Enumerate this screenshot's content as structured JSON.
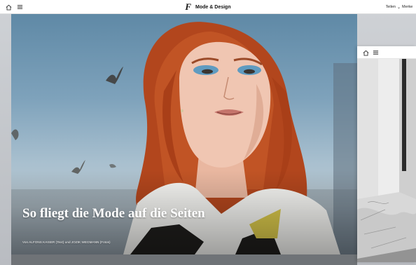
{
  "topbar": {
    "home_icon": "home-icon",
    "menu_icon": "menu-icon",
    "logo": "F",
    "title": "Mode & Design",
    "share_label": "Teilen",
    "more_label": "Merke"
  },
  "hero": {
    "headline": "So fliegt die Mode auf die Seiten",
    "byline": "Von ALFONS KAISER (Text) und JOZIK WEGMANN (Fotos)"
  },
  "peek_card": {
    "home_icon": "home-icon",
    "menu_icon": "menu-icon"
  },
  "colors": {
    "sky_top": "#5f89a6",
    "sky_bottom": "#bac7cf",
    "hair": "#b2461d",
    "topbar_bg": "#ffffff",
    "strip": "#6f7377"
  }
}
